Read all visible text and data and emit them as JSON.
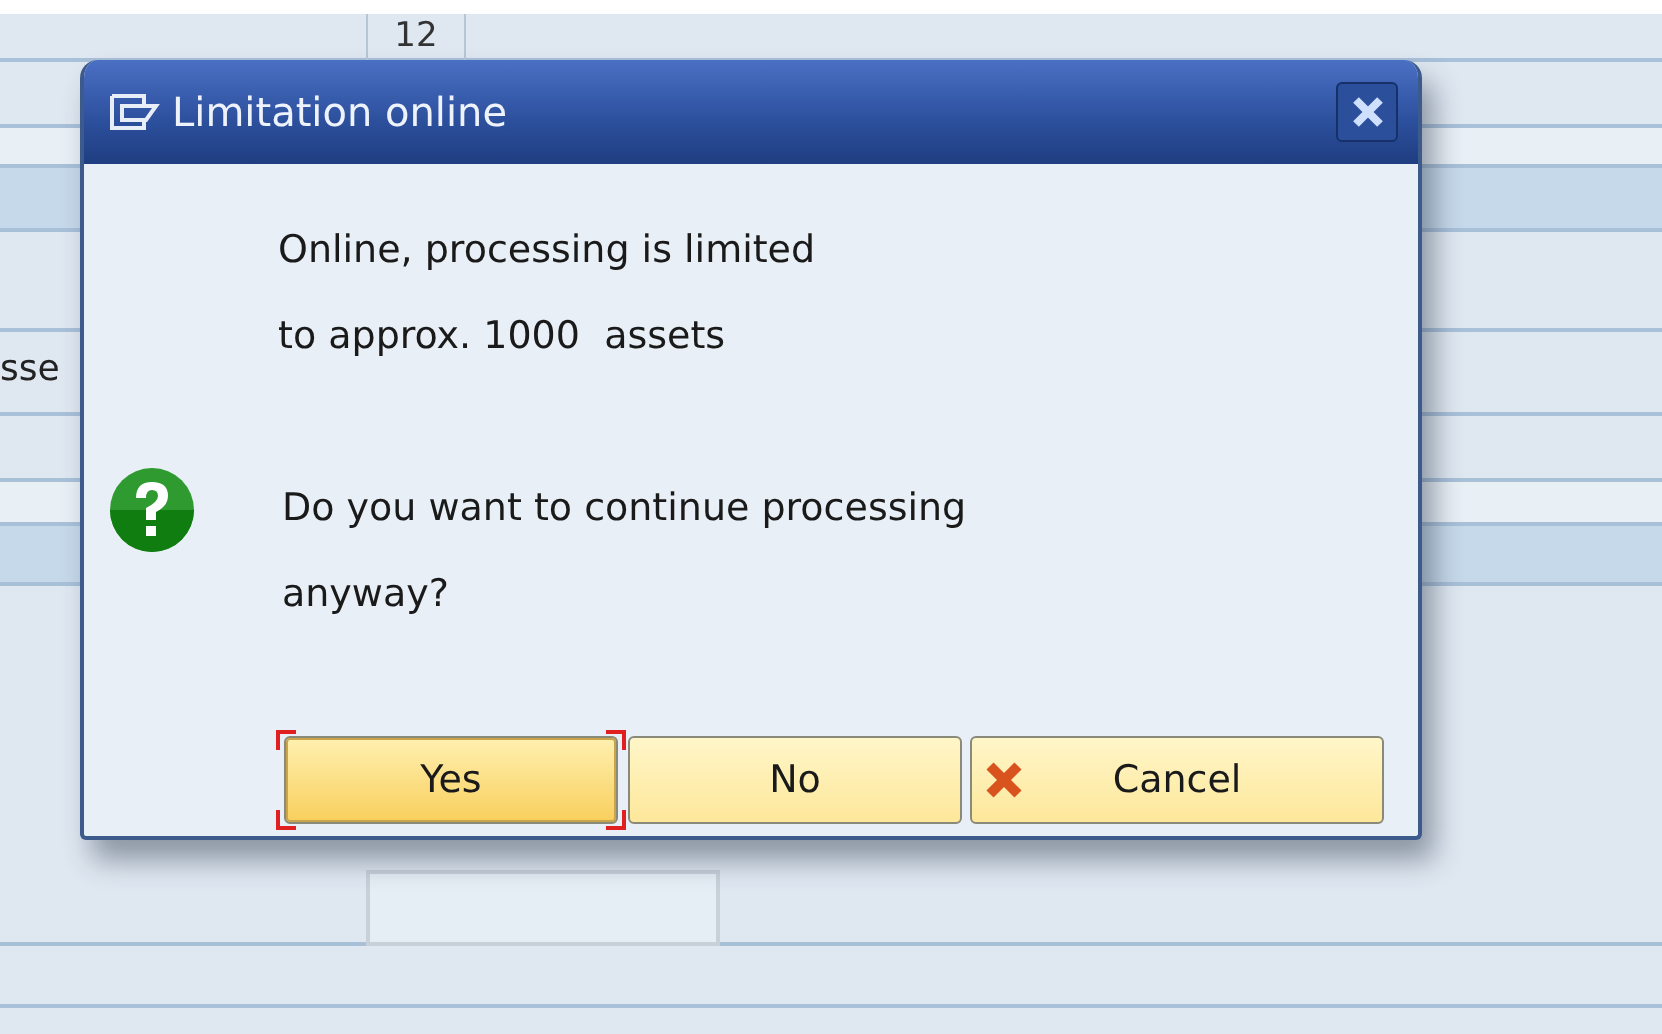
{
  "background": {
    "top_cell": "12",
    "side_label": "sse"
  },
  "dialog": {
    "title": "Limitation online",
    "message": [
      "Online, processing is limited",
      "to approx. 1000  assets"
    ],
    "question": [
      "Do you want to continue processing",
      "anyway?"
    ],
    "buttons": [
      {
        "label": "Yes",
        "kind": "plain",
        "focused": true
      },
      {
        "label": "No",
        "kind": "plain",
        "focused": false
      },
      {
        "label": "Cancel",
        "kind": "cancel",
        "focused": false
      }
    ]
  }
}
